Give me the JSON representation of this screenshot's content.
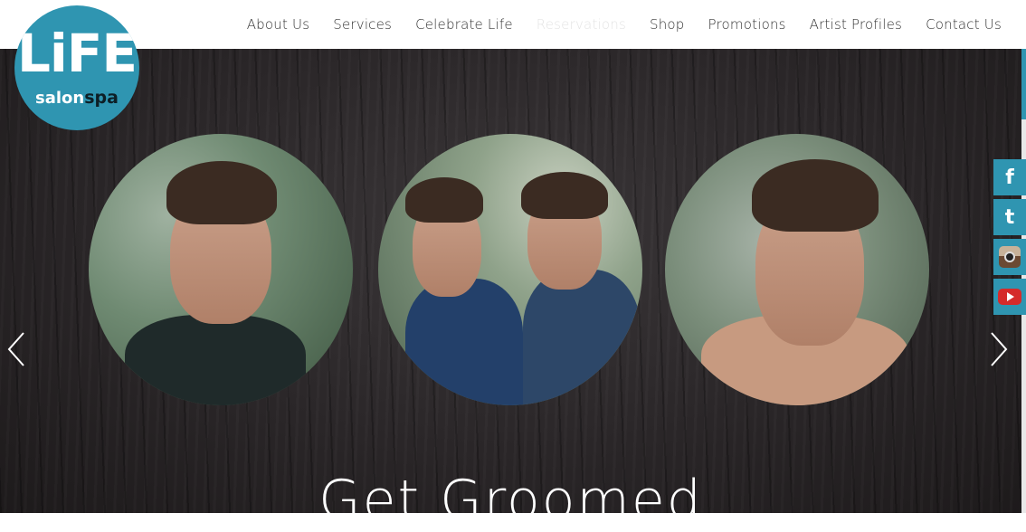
{
  "brand": {
    "logo_big": "LiFE",
    "logo_salon": "salon",
    "logo_spa": "spa"
  },
  "nav": {
    "items": [
      {
        "label": "About Us"
      },
      {
        "label": "Services"
      },
      {
        "label": "Celebrate Life"
      },
      {
        "label": "Reservations"
      },
      {
        "label": "Shop"
      },
      {
        "label": "Promotions"
      },
      {
        "label": "Artist Profiles"
      },
      {
        "label": "Contact Us"
      }
    ]
  },
  "hero": {
    "headline": "Get Groomed",
    "slides": [
      "portrait-man-1",
      "two-men-outdoors",
      "portrait-man-2"
    ]
  },
  "social": {
    "items": [
      {
        "icon": "facebook-icon",
        "glyph": "f"
      },
      {
        "icon": "tumblr-icon",
        "glyph": "t"
      },
      {
        "icon": "instagram-icon"
      },
      {
        "icon": "youtube-icon"
      }
    ]
  },
  "colors": {
    "accent": "#2f95b1",
    "hero_bg": "#2a2628",
    "nav_text": "#333333"
  }
}
